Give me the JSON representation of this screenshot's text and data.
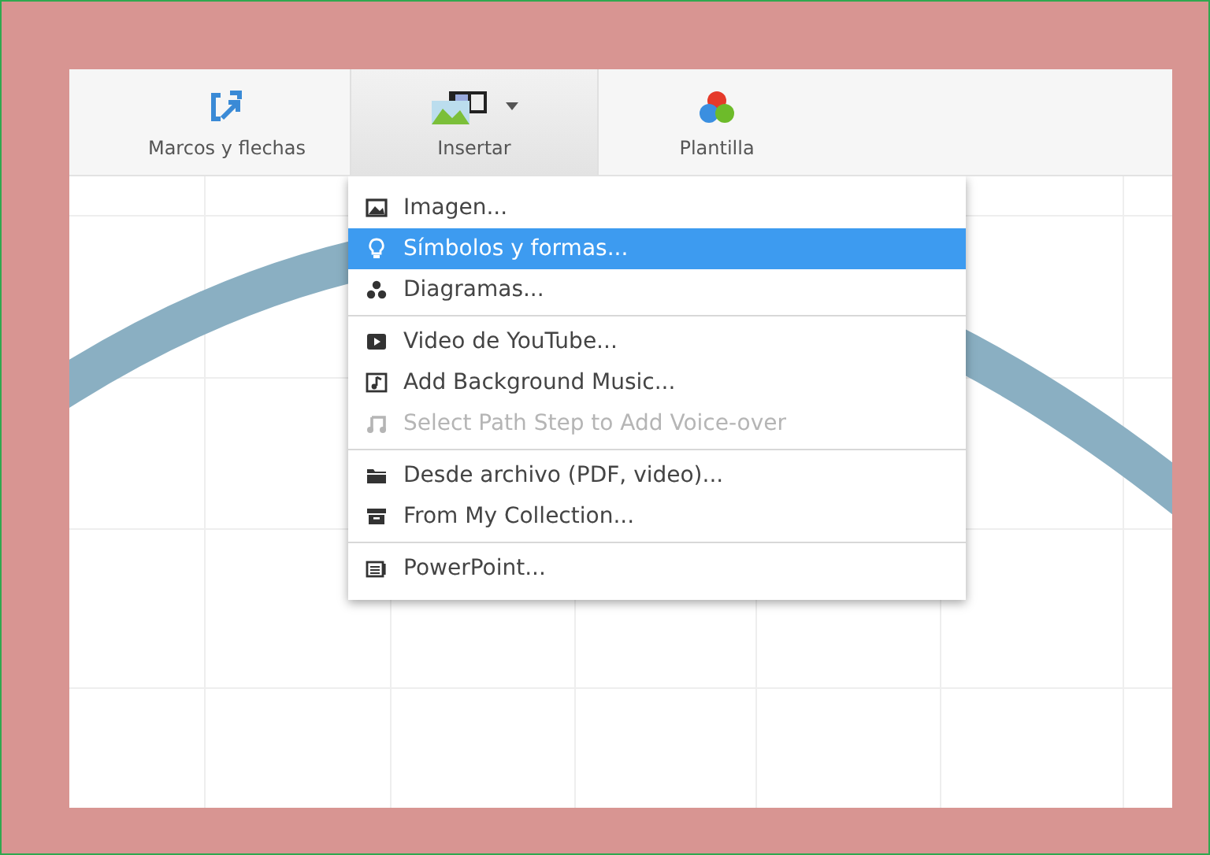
{
  "toolbar": {
    "buttons": [
      {
        "label": "Marcos y flechas",
        "kind": "frames",
        "selected": false
      },
      {
        "label": "Insertar",
        "kind": "insert",
        "selected": true
      },
      {
        "label": "Plantilla",
        "kind": "theme",
        "selected": false
      }
    ]
  },
  "menu": {
    "groups": [
      [
        {
          "label": "Imagen...",
          "kind": "image",
          "selected": false,
          "disabled": false
        },
        {
          "label": "Símbolos y formas...",
          "kind": "bulb",
          "selected": true,
          "disabled": false
        },
        {
          "label": "Diagramas...",
          "kind": "diagram",
          "selected": false,
          "disabled": false
        }
      ],
      [
        {
          "label": "Video de YouTube...",
          "kind": "video",
          "selected": false,
          "disabled": false
        },
        {
          "label": "Add Background Music...",
          "kind": "music",
          "selected": false,
          "disabled": false
        },
        {
          "label": "Select Path Step to Add Voice-over",
          "kind": "note",
          "selected": false,
          "disabled": true
        }
      ],
      [
        {
          "label": "Desde archivo (PDF, video)...",
          "kind": "folder",
          "selected": false,
          "disabled": false
        },
        {
          "label": "From My Collection...",
          "kind": "archive",
          "selected": false,
          "disabled": false
        }
      ],
      [
        {
          "label": "PowerPoint...",
          "kind": "slides",
          "selected": false,
          "disabled": false
        }
      ]
    ]
  }
}
